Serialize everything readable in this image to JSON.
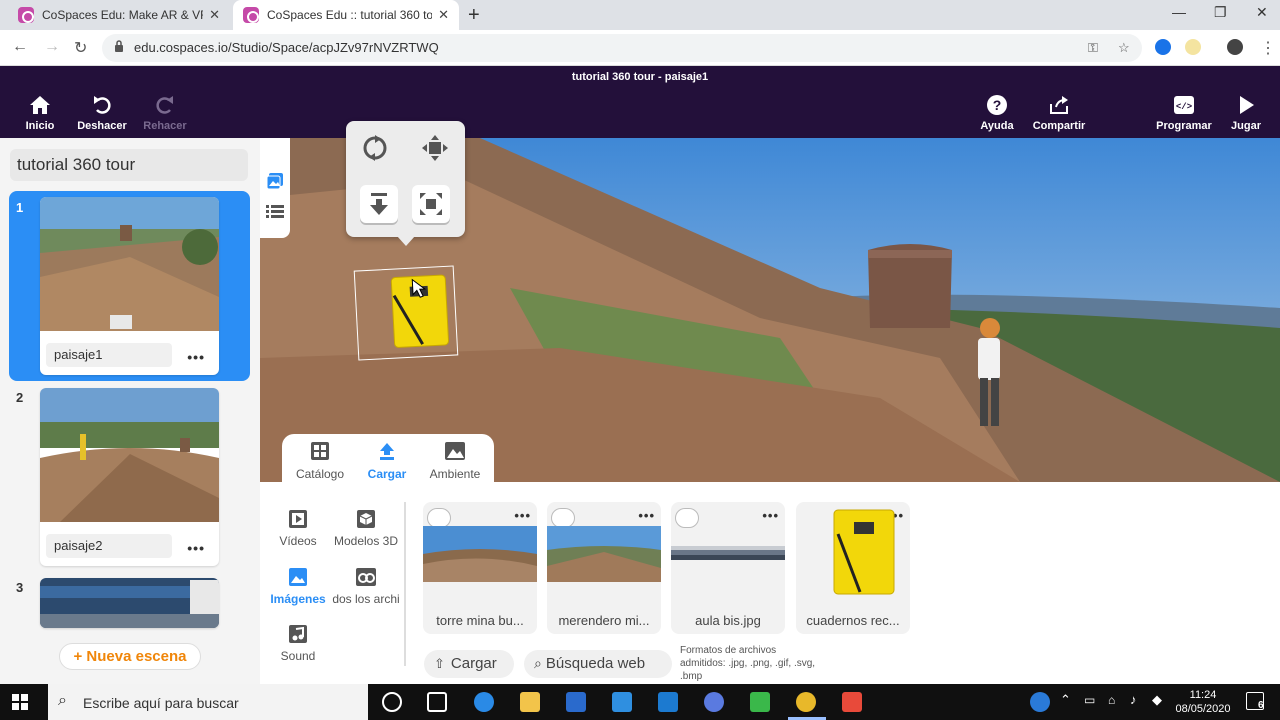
{
  "browser": {
    "tabs": [
      {
        "title": "CoSpaces Edu: Make AR & VR in"
      },
      {
        "title": "CoSpaces Edu :: tutorial 360 tour"
      }
    ],
    "url": "edu.cospaces.io/Studio/Space/acpJZv97rNVZRTWQ"
  },
  "header": {
    "doc_title": "tutorial 360 tour - paisaje1",
    "inicio": "Inicio",
    "deshacer": "Deshacer",
    "rehacer": "Rehacer",
    "ayuda": "Ayuda",
    "compartir": "Compartir",
    "programar": "Programar",
    "jugar": "Jugar"
  },
  "project": {
    "title": "tutorial 360 tour"
  },
  "scenes": [
    {
      "num": "1",
      "label": "paisaje1"
    },
    {
      "num": "2",
      "label": "paisaje2"
    },
    {
      "num": "3",
      "label": ""
    }
  ],
  "new_scene": "+ Nueva escena",
  "library": {
    "tabs": {
      "catalogo": "Catálogo",
      "cargar": "Cargar",
      "ambiente": "Ambiente"
    },
    "categories": {
      "videos": "Vídeos",
      "modelos": "Modelos 3D",
      "imagenes": "Imágenes",
      "todos": "dos los archi",
      "sound": "Sound"
    },
    "assets": [
      {
        "name": "torre mina bu..."
      },
      {
        "name": "merendero mi..."
      },
      {
        "name": "aula bis.jpg"
      },
      {
        "name": "cuadernos rec..."
      }
    ],
    "cargar_btn": "Cargar",
    "busqueda_btn": "Búsqueda web",
    "formats": "Formatos de archivos admitidos: .jpg, .png, .gif, .svg, .bmp"
  },
  "taskbar": {
    "search_placeholder": "Escribe aquí para buscar",
    "time": "11:24",
    "date": "08/05/2020",
    "notif_count": "6"
  },
  "colors": {
    "header_bg": "#23103a",
    "accent_blue": "#2b8ef5",
    "accent_orange": "#f0860a"
  }
}
